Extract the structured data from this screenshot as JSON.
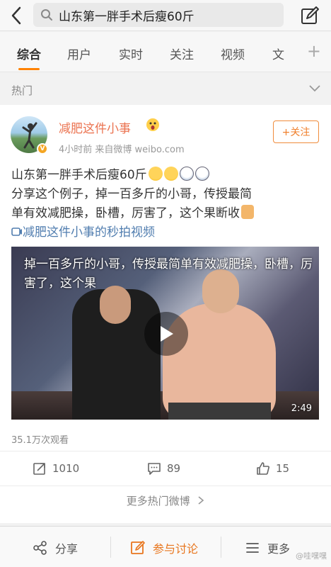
{
  "search": {
    "query": "山东第一胖手术后瘦60斤"
  },
  "tabs": [
    {
      "label": "综合"
    },
    {
      "label": "用户"
    },
    {
      "label": "实时"
    },
    {
      "label": "关注"
    },
    {
      "label": "视频"
    },
    {
      "label": "文"
    }
  ],
  "section": {
    "label": "热门"
  },
  "post": {
    "username": "减肥这件小事",
    "meta": "4小时前  来自微博 weibo.com",
    "follow_label": "+关注",
    "text_line1": "山东第一胖手术后瘦60斤",
    "text_line2": "分享这个例子，掉一百多斤的小哥，传授最简",
    "text_line3": "单有效减肥操，卧槽，厉害了，这个果断收",
    "link_text": "减肥这件小事的秒拍视频",
    "video_caption": "掉一百多斤的小哥，传授最简单有效减肥操，卧槽，厉害了，这个果",
    "duration": "2:49",
    "views": "35.1万次观看",
    "reposts": "1010",
    "comments": "89",
    "likes": "15",
    "more_hot": "更多热门微博"
  },
  "bottom": {
    "share": "分享",
    "discuss": "参与讨论",
    "more": "更多"
  },
  "watermark": "@哇嘿嘿",
  "colors": {
    "accent": "#ff8200",
    "username": "#eb7350",
    "link": "#507daf"
  }
}
